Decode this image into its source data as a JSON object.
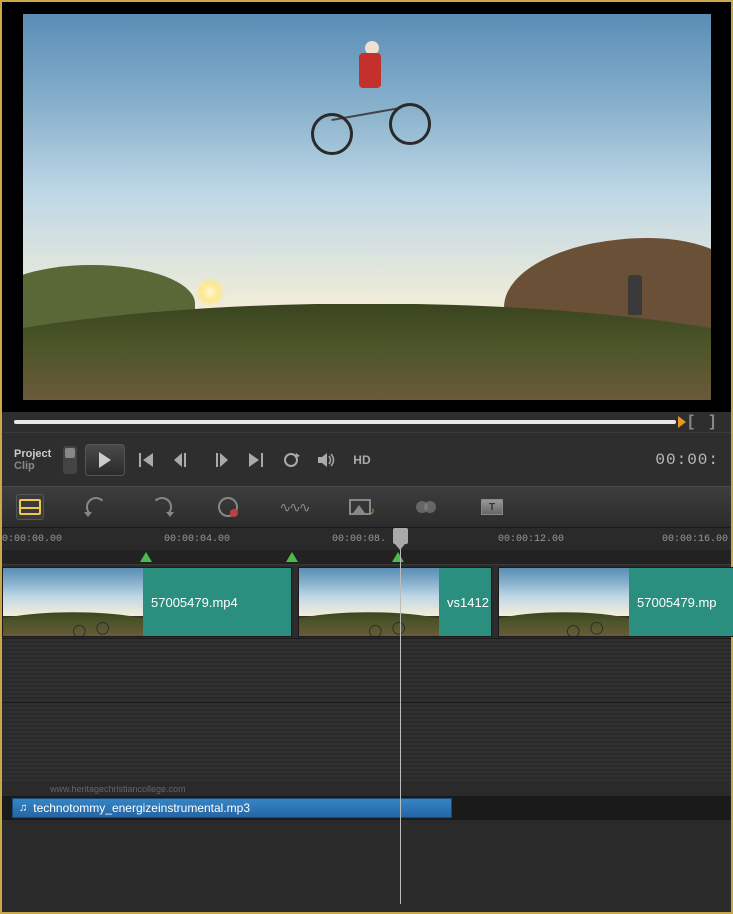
{
  "mode": {
    "project": "Project",
    "clip": "Clip"
  },
  "playback": {
    "hd": "HD"
  },
  "timecode": {
    "display": "00:00:"
  },
  "ruler": {
    "t0": "0:00:00.00",
    "t4": "00:00:04.00",
    "t8": "00:00:08.",
    "t12": "00:00:12.00",
    "t16": "00:00:16.00"
  },
  "clips": [
    {
      "label": "57005479.mp4"
    },
    {
      "label": "vs1412"
    },
    {
      "label": "57005479.mp"
    }
  ],
  "audio": {
    "label": "technotommy_energizeinstrumental.mp3"
  },
  "watermark": "www.heritagechristiancollege.com",
  "text_tool": "T"
}
